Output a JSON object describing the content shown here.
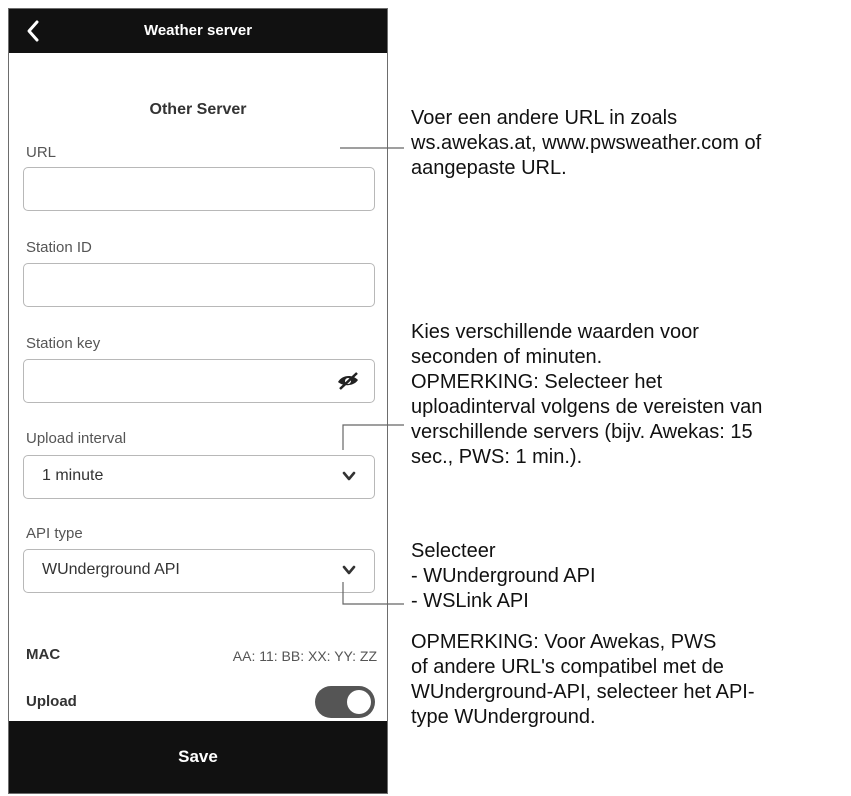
{
  "header": {
    "title": "Weather server"
  },
  "form": {
    "section_title": "Other Server",
    "url": {
      "label": "URL",
      "value": ""
    },
    "station_id": {
      "label": "Station ID",
      "value": ""
    },
    "station_key": {
      "label": "Station key",
      "value": ""
    },
    "upload_interval": {
      "label": "Upload interval",
      "value": "1 minute"
    },
    "api_type": {
      "label": "API type",
      "value": "WUnderground API"
    },
    "mac": {
      "label": "MAC",
      "value": "AA: 11: BB: XX: YY: ZZ"
    },
    "upload": {
      "label": "Upload",
      "enabled": true
    }
  },
  "footer": {
    "save_label": "Save"
  },
  "annotations": {
    "url_note": [
      "Voer een andere URL in zoals",
      "ws.awekas.at, www.pwsweather.com of",
      "aangepaste URL."
    ],
    "interval_note": [
      "Kies verschillende waarden voor",
      "seconden of minuten."
    ],
    "interval_remark": [
      "OPMERKING: Selecteer het",
      "uploadinterval volgens de vereisten van",
      "verschillende servers (bijv. Awekas: 15",
      "sec., PWS: 1 min.)."
    ],
    "api_note": [
      "Selecteer",
      "- WUnderground API",
      "- WSLink API"
    ],
    "api_remark": [
      "OPMERKING: Voor Awekas, PWS",
      "of andere URL's compatibel met de",
      "WUnderground-API, selecteer het API-",
      "type WUnderground."
    ]
  }
}
